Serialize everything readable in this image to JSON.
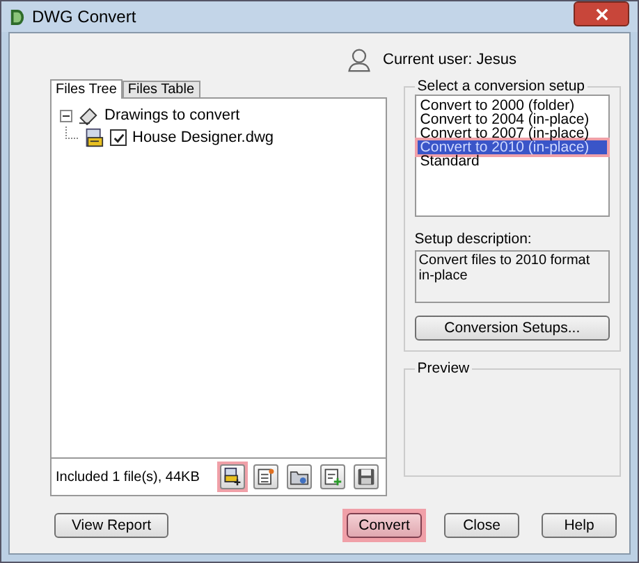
{
  "window": {
    "title": "DWG Convert"
  },
  "current_user": "Current user: Jesus",
  "tabs": [
    {
      "label": "Files Tree",
      "selected": true
    },
    {
      "label": "Files Table",
      "selected": false
    }
  ],
  "tree": [
    {
      "label": "Drawings to convert",
      "expanded": true,
      "children": [
        {
          "label": "House Designer.dwg",
          "checked": true
        }
      ]
    }
  ],
  "status": "Included 1 file(s), 44KB",
  "toolbar": [
    {
      "kind": "add",
      "highlighted": true
    },
    {
      "kind": "list",
      "highlighted": false
    },
    {
      "kind": "folder",
      "highlighted": false
    },
    {
      "kind": "append",
      "highlighted": false
    },
    {
      "kind": "save",
      "highlighted": false
    }
  ],
  "conversion_setup": {
    "label": "Select a conversion setup",
    "options": [
      {
        "label": "Convert to 2000 (folder)",
        "selected": false,
        "highlighted": false
      },
      {
        "label": "Convert to 2004 (in-place)",
        "selected": false,
        "highlighted": false
      },
      {
        "label": "Convert to 2007 (in-place)",
        "selected": false,
        "highlighted": false
      },
      {
        "label": "Convert to 2010 (in-place)",
        "selected": true,
        "highlighted": true
      },
      {
        "label": "Standard",
        "selected": false,
        "highlighted": false
      }
    ],
    "description_label": "Setup description:",
    "description": "Convert files to 2010 format in-place",
    "button": "Conversion Setups..."
  },
  "preview": {
    "label": "Preview"
  },
  "buttons": [
    {
      "label": "View Report",
      "highlighted": false
    },
    {
      "label": "Convert",
      "highlighted": true
    },
    {
      "label": "Close",
      "highlighted": false
    },
    {
      "label": "Help",
      "highlighted": false
    }
  ]
}
